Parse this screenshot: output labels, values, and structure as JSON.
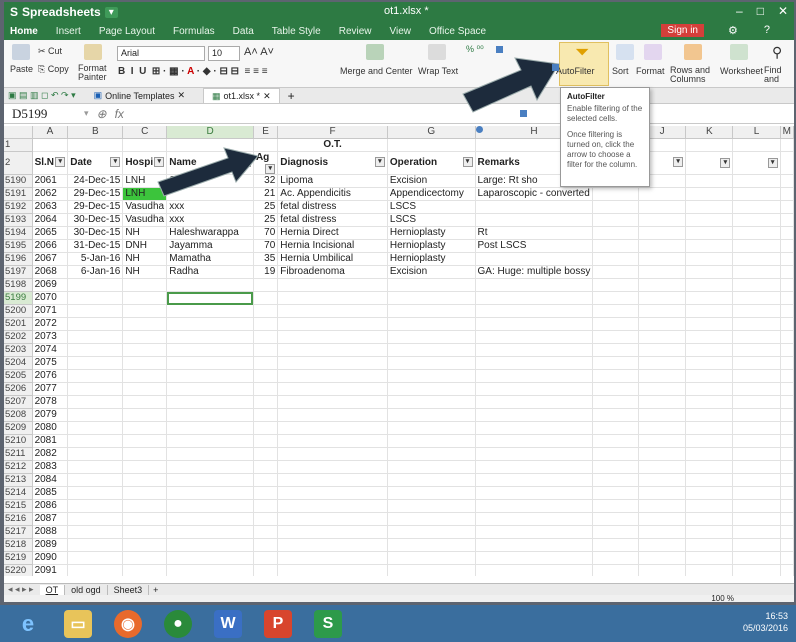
{
  "app": {
    "name": "Spreadsheets",
    "doc_title": "ot1.xlsx *"
  },
  "menu": {
    "tabs": [
      "Home",
      "Insert",
      "Page Layout",
      "Formulas",
      "Data",
      "Table Style",
      "Review",
      "View",
      "Office Space"
    ],
    "signin": "Sign in"
  },
  "ribbon": {
    "cut": "Cut",
    "copy": "Copy",
    "paste": "Paste",
    "format_painter": "Format Painter",
    "font_name": "Arial",
    "font_size": "10",
    "merge": "Merge and Center",
    "wrap": "Wrap Text",
    "autofilter": "AutoFilter",
    "sort": "Sort",
    "format": "Format",
    "rows_cols": "Rows and Columns",
    "worksheet": "Worksheet",
    "find_replace": "Find and Replace"
  },
  "doc_tabs": [
    "Online Templates",
    "ot1.xlsx *"
  ],
  "formula_bar": {
    "cell_ref": "D5199",
    "fx": "fx"
  },
  "tooltip": {
    "title": "AutoFilter",
    "p1": "Enable filtering of the selected cells.",
    "p2": "Once filtering is turned on, click the arrow to choose a filter for the column."
  },
  "grid": {
    "columns": [
      "A",
      "B",
      "C",
      "D",
      "E",
      "F",
      "G",
      "H",
      "I",
      "J",
      "K",
      "L",
      "M"
    ],
    "title_row": {
      "num": "1",
      "title": "O.T."
    },
    "header_row": {
      "num": "2",
      "cells": [
        "Sl.N",
        "Date",
        "Hospi",
        "Name",
        "Ag",
        "Diagnosis",
        "Operation",
        "Remarks",
        "",
        "s",
        "",
        "",
        ""
      ]
    },
    "rows": [
      {
        "num": "5190",
        "cells": [
          "2061",
          "24-Dec-15",
          "LNH",
          "Sh",
          "",
          "32",
          "Lipoma",
          "Excision",
          "Large: Rt sho"
        ]
      },
      {
        "num": "5191",
        "cells": [
          "2062",
          "29-Dec-15",
          "LNH",
          "",
          "",
          "21",
          "Ac. Appendicitis",
          "Appendicectomy",
          "Laparoscopic - converted"
        ]
      },
      {
        "num": "5192",
        "cells": [
          "2063",
          "29-Dec-15",
          "Vasudha",
          "xxx",
          "",
          "25",
          "fetal distress",
          "LSCS",
          ""
        ]
      },
      {
        "num": "5193",
        "cells": [
          "2064",
          "30-Dec-15",
          "Vasudha",
          "xxx",
          "",
          "25",
          "fetal distress",
          "LSCS",
          ""
        ]
      },
      {
        "num": "5194",
        "cells": [
          "2065",
          "30-Dec-15",
          "NH",
          "Haleshwarappa",
          "",
          "70",
          "Hernia Direct",
          "Hernioplasty",
          "Rt"
        ]
      },
      {
        "num": "5195",
        "cells": [
          "2066",
          "31-Dec-15",
          "DNH",
          "Jayamma",
          "",
          "70",
          "Hernia Incisional",
          "Hernioplasty",
          "Post LSCS"
        ]
      },
      {
        "num": "5196",
        "cells": [
          "2067",
          "5-Jan-16",
          "NH",
          "Mamatha",
          "",
          "35",
          "Hernia Umbilical",
          "Hernioplasty",
          ""
        ]
      },
      {
        "num": "5197",
        "cells": [
          "2068",
          "6-Jan-16",
          "NH",
          "Radha",
          "",
          "19",
          "Fibroadenoma",
          "Excision",
          "GA: Huge: multiple bossy"
        ]
      }
    ],
    "empty_rows": [
      [
        "5198",
        "2069"
      ],
      [
        "5199",
        "2070"
      ],
      [
        "5200",
        "2071"
      ],
      [
        "5201",
        "2072"
      ],
      [
        "5202",
        "2073"
      ],
      [
        "5203",
        "2074"
      ],
      [
        "5204",
        "2075"
      ],
      [
        "5205",
        "2076"
      ],
      [
        "5206",
        "2077"
      ],
      [
        "5207",
        "2078"
      ],
      [
        "5208",
        "2079"
      ],
      [
        "5209",
        "2080"
      ],
      [
        "5210",
        "2081"
      ],
      [
        "5211",
        "2082"
      ],
      [
        "5212",
        "2083"
      ],
      [
        "5213",
        "2084"
      ],
      [
        "5214",
        "2085"
      ],
      [
        "5215",
        "2086"
      ],
      [
        "5216",
        "2087"
      ],
      [
        "5217",
        "2088"
      ],
      [
        "5218",
        "2089"
      ],
      [
        "5219",
        "2090"
      ],
      [
        "5220",
        "2091"
      ]
    ]
  },
  "sheets": [
    "OT",
    "old ogd",
    "Sheet3"
  ],
  "zoom": "100 %",
  "clock": {
    "time": "16:53",
    "date": "05/03/2016"
  },
  "colors": {
    "brand": "#2d7a43",
    "taskbar": "#3a6e9e",
    "selection": "#4a9a4a"
  }
}
